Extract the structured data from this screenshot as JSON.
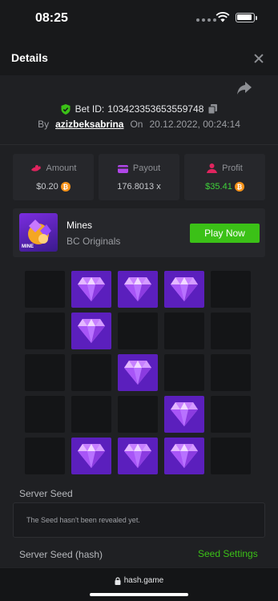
{
  "status_bar": {
    "time": "08:25"
  },
  "header": {
    "title": "Details"
  },
  "bet": {
    "id_label": "Bet ID:",
    "id_value": "103423353653559748",
    "by_label": "By",
    "user": "azizbeksabrina",
    "on_label": "On",
    "date": "20.12.2022, 00:24:14"
  },
  "stats": {
    "amount": {
      "label": "Amount",
      "value": "$0.20"
    },
    "payout": {
      "label": "Payout",
      "value": "176.8013 x"
    },
    "profit": {
      "label": "Profit",
      "value": "$35.41"
    }
  },
  "game": {
    "name": "Mines",
    "provider": "BC Originals",
    "thumb_tag": "MINE",
    "play_label": "Play Now"
  },
  "mines_grid": {
    "rows": 5,
    "cols": 5,
    "cells": [
      0,
      1,
      1,
      1,
      0,
      0,
      1,
      0,
      0,
      0,
      0,
      0,
      1,
      0,
      0,
      0,
      0,
      0,
      1,
      0,
      0,
      1,
      1,
      1,
      0
    ]
  },
  "seeds": {
    "server_seed_label": "Server Seed",
    "server_seed_text": "The Seed hasn't been revealed yet.",
    "server_seed_hash_label": "Server Seed (hash)",
    "seed_settings_label": "Seed Settings"
  },
  "browser": {
    "url": "hash.game"
  },
  "colors": {
    "accent_green": "#3bc117",
    "gem_tile": "#5b1fbd",
    "btc": "#f7931a"
  }
}
